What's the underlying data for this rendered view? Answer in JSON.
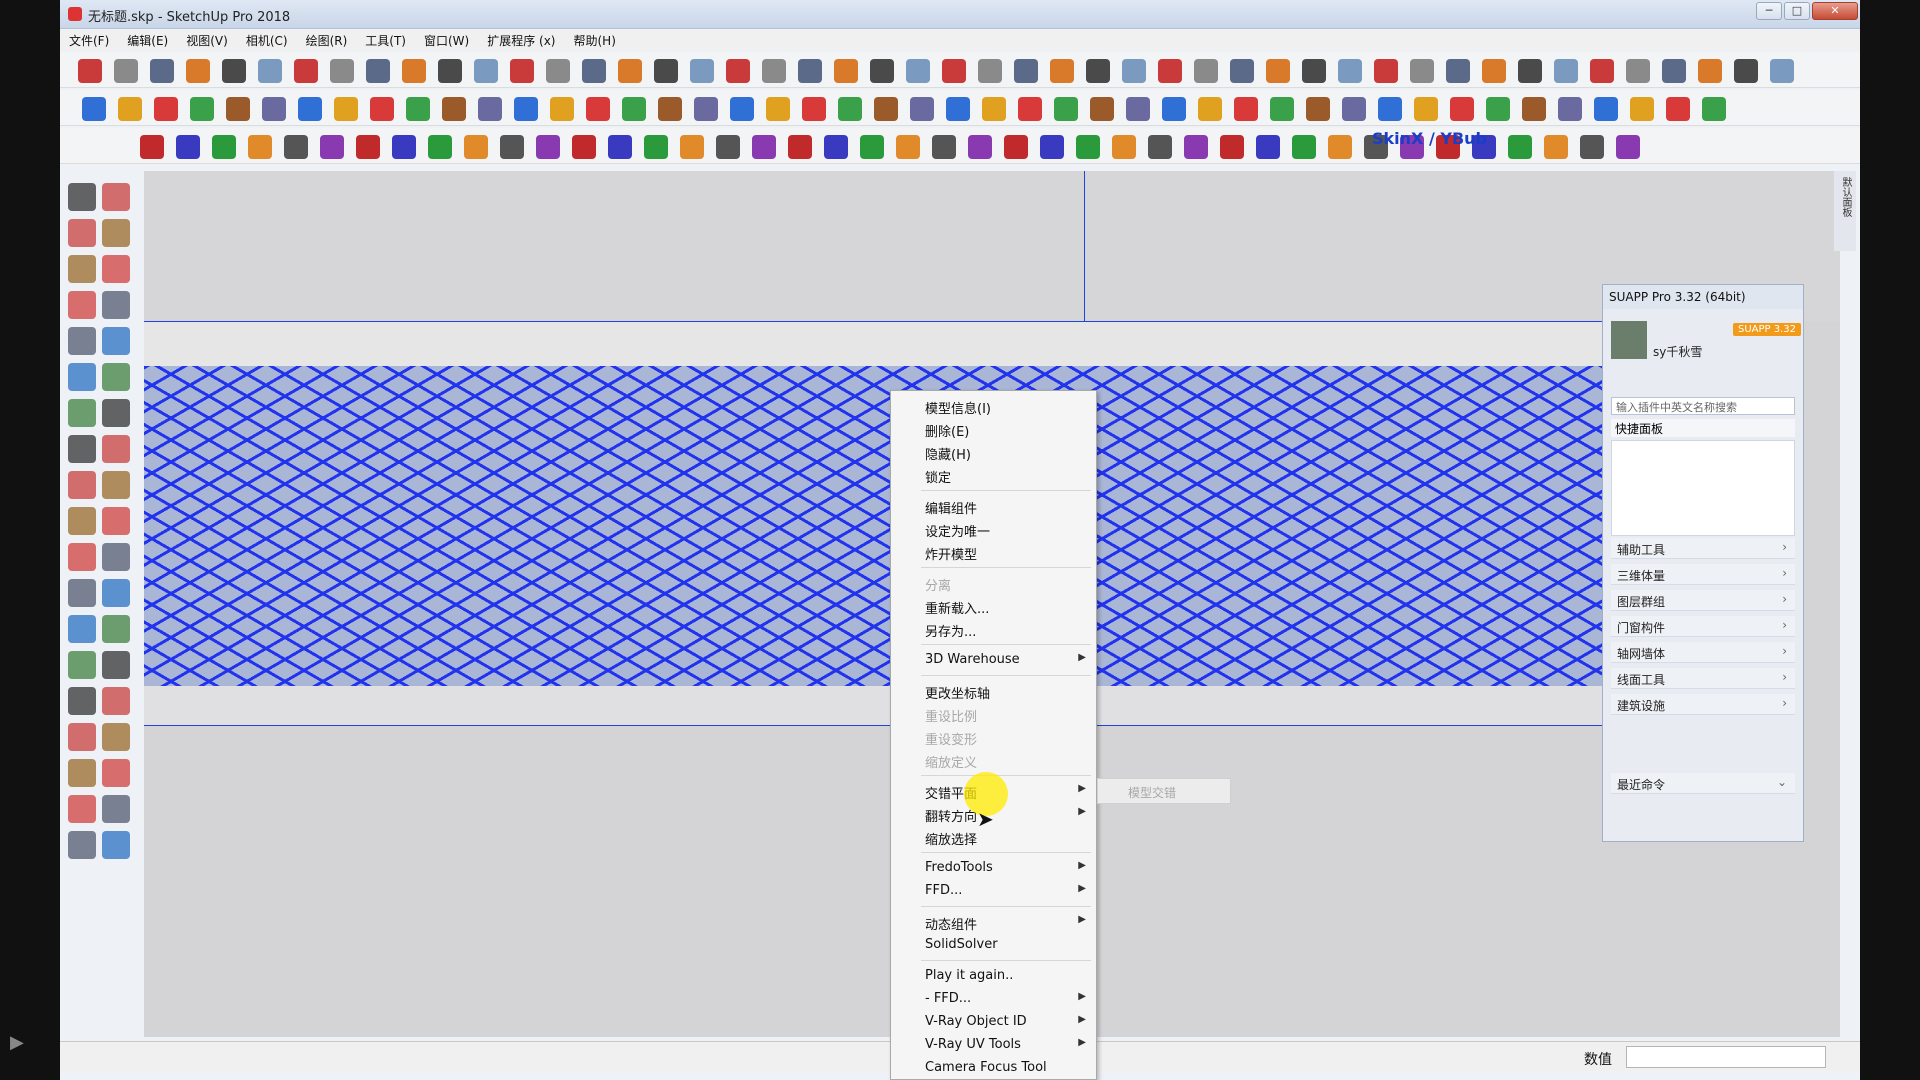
{
  "window": {
    "title": "无标题.skp - SketchUp Pro 2018",
    "controls": [
      "─",
      "□",
      "✕"
    ]
  },
  "menubar": [
    "文件(F)",
    "编辑(E)",
    "视图(V)",
    "相机(C)",
    "绘图(R)",
    "工具(T)",
    "窗口(W)",
    "扩展程序 (x)",
    "帮助(H)"
  ],
  "toolbar": {
    "skinx_label": "SkinX / YBub"
  },
  "suapp": {
    "title": "SUAPP Pro 3.32 (64bit)",
    "user_name": "sy千秋雪",
    "badge": "SUAPP 3.32",
    "search_placeholder": "输入插件中英文名称搜索",
    "quick_panel": "快捷面板",
    "categories": [
      "辅助工具",
      "三维体量",
      "图层群组",
      "门窗构件",
      "轴网墙体",
      "线面工具",
      "建筑设施"
    ],
    "recent": "最近命令"
  },
  "context_menu": {
    "items": [
      {
        "label": "模型信息(I)",
        "disabled": false,
        "sub": false
      },
      {
        "label": "删除(E)",
        "disabled": false,
        "sub": false
      },
      {
        "label": "隐藏(H)",
        "disabled": false,
        "sub": false
      },
      {
        "label": "锁定",
        "disabled": false,
        "sub": false
      },
      {
        "label": "编辑组件",
        "disabled": false,
        "sub": false
      },
      {
        "label": "设定为唯一",
        "disabled": false,
        "sub": false
      },
      {
        "label": "炸开模型",
        "disabled": false,
        "sub": false
      },
      {
        "label": "分离",
        "disabled": true,
        "sub": false
      },
      {
        "label": "重新载入...",
        "disabled": false,
        "sub": false
      },
      {
        "label": "另存为...",
        "disabled": false,
        "sub": false
      },
      {
        "label": "3D Warehouse",
        "disabled": false,
        "sub": true
      },
      {
        "label": "更改坐标轴",
        "disabled": false,
        "sub": false
      },
      {
        "label": "重设比例",
        "disabled": true,
        "sub": false
      },
      {
        "label": "重设变形",
        "disabled": true,
        "sub": false
      },
      {
        "label": "缩放定义",
        "disabled": true,
        "sub": false
      },
      {
        "label": "交错平面",
        "disabled": false,
        "sub": true
      },
      {
        "label": "翻转方向",
        "disabled": false,
        "sub": true
      },
      {
        "label": "缩放选择",
        "disabled": false,
        "sub": false
      },
      {
        "label": "FredoTools",
        "disabled": false,
        "sub": true
      },
      {
        "label": "FFD...",
        "disabled": false,
        "sub": true
      },
      {
        "label": "动态组件",
        "disabled": false,
        "sub": true
      },
      {
        "label": "SolidSolver",
        "disabled": false,
        "sub": false
      },
      {
        "label": "Play it again..",
        "disabled": false,
        "sub": false
      },
      {
        "label": "- FFD...",
        "disabled": false,
        "sub": true
      },
      {
        "label": "V-Ray Object ID",
        "disabled": false,
        "sub": true
      },
      {
        "label": "V-Ray UV Tools",
        "disabled": false,
        "sub": true
      },
      {
        "label": "Camera Focus Tool",
        "disabled": false,
        "sub": false
      }
    ],
    "submenu_item": "模型交错"
  },
  "status": {
    "measure_label": "数值",
    "measure_value": ""
  },
  "right_strip": "默认面板",
  "colors": {
    "grate": "#2233ee",
    "grate_bg": "#aab6d6",
    "highlight": "#ffeb00"
  }
}
